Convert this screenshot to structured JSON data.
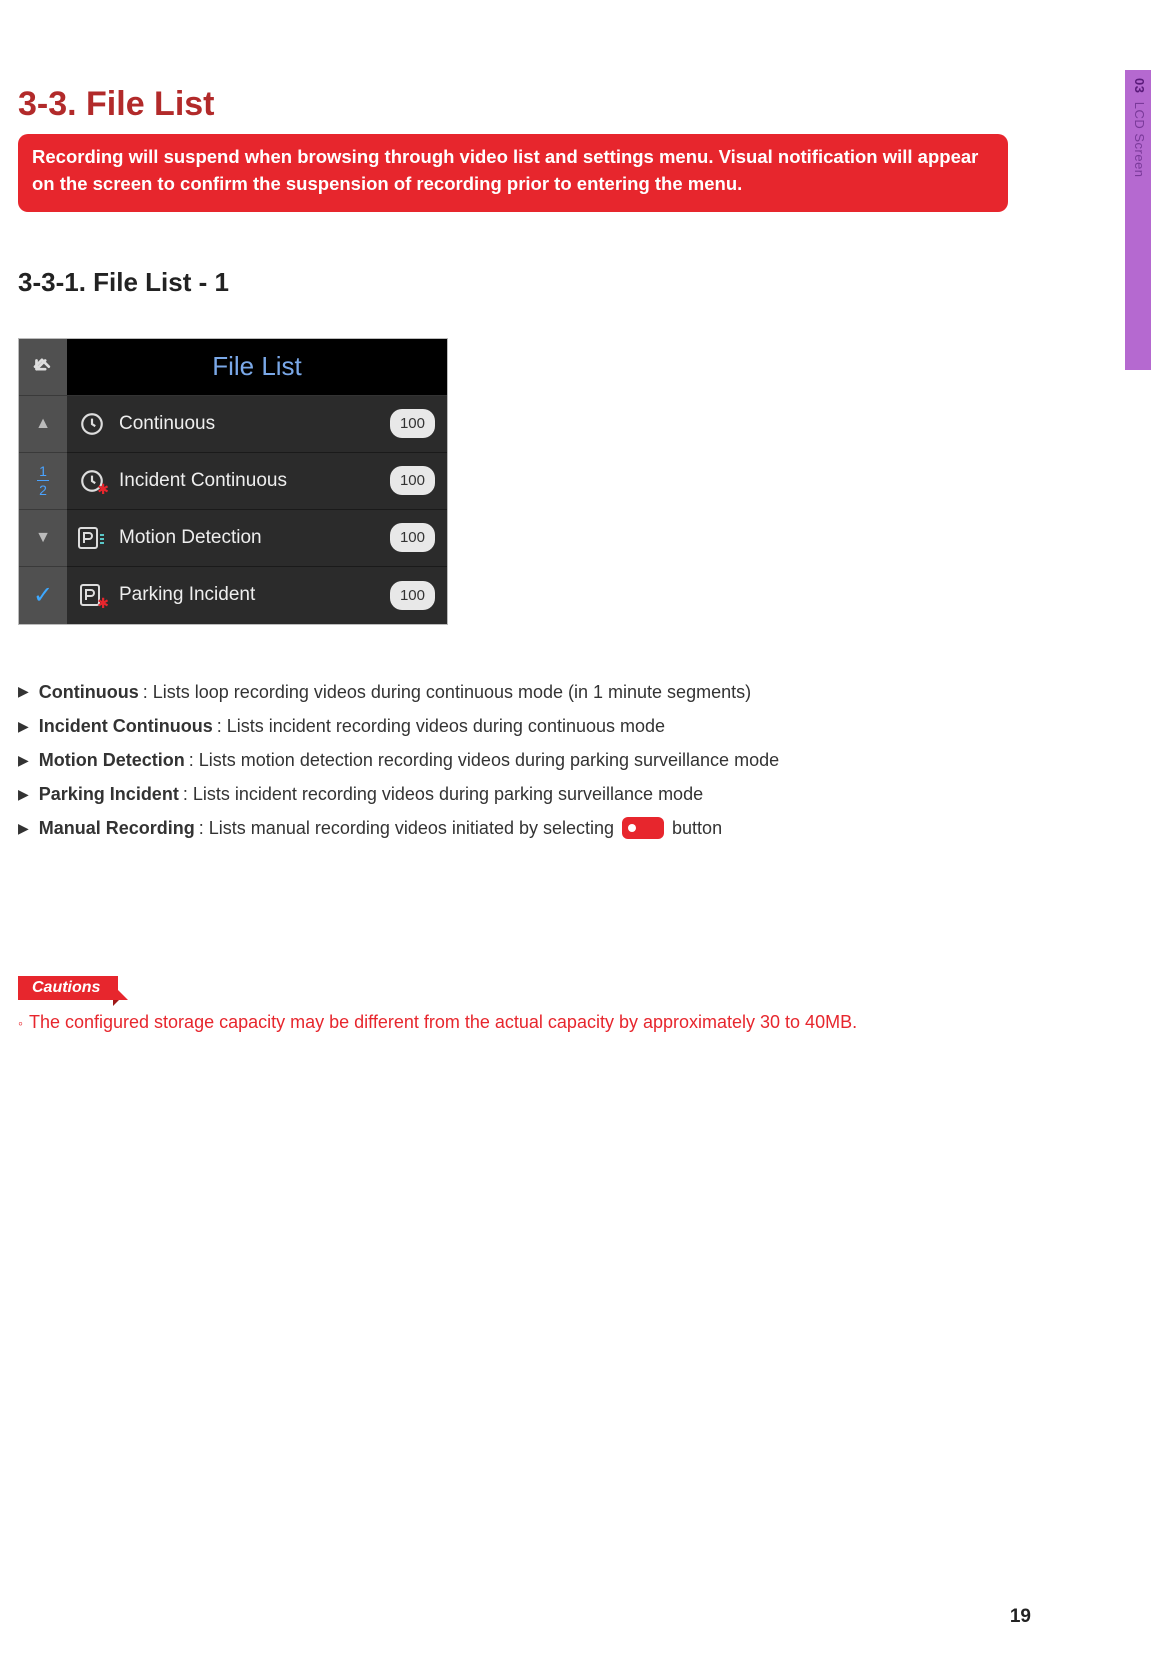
{
  "side_tab": {
    "num": "03",
    "label": "LCD Screen"
  },
  "section_title": "3-3. File List",
  "warning": "Recording will suspend when browsing through video list and settings menu. Visual notification will appear on the screen to confirm the suspension of recording prior to entering the menu.",
  "subsection": "3-3-1. File List - 1",
  "device": {
    "title": "File List",
    "page_frac_top": "1",
    "page_frac_bottom": "2",
    "rows": [
      {
        "label": "Continuous",
        "count": "100"
      },
      {
        "label": "Incident Continuous",
        "count": "100"
      },
      {
        "label": "Motion Detection",
        "count": "100"
      },
      {
        "label": "Parking Incident",
        "count": "100"
      }
    ]
  },
  "descriptions": [
    {
      "term": "Continuous",
      "text": " : Lists loop recording videos during continuous mode (in 1 minute segments)"
    },
    {
      "term": "Incident Continuous",
      "text": " : Lists incident recording videos during continuous mode"
    },
    {
      "term": "Motion Detection",
      "text": " : Lists motion detection recording videos during parking surveillance mode"
    },
    {
      "term": "Parking Incident",
      "text": " : Lists incident recording videos during parking surveillance mode"
    },
    {
      "term": "Manual Recording",
      "text_a": " : Lists manual recording videos initiated by selecting ",
      "text_b": " button"
    }
  ],
  "cautions_label": "Cautions",
  "caution_text": "The configured storage capacity may be different from the actual capacity by approximately 30 to 40MB.",
  "page_number": "19"
}
